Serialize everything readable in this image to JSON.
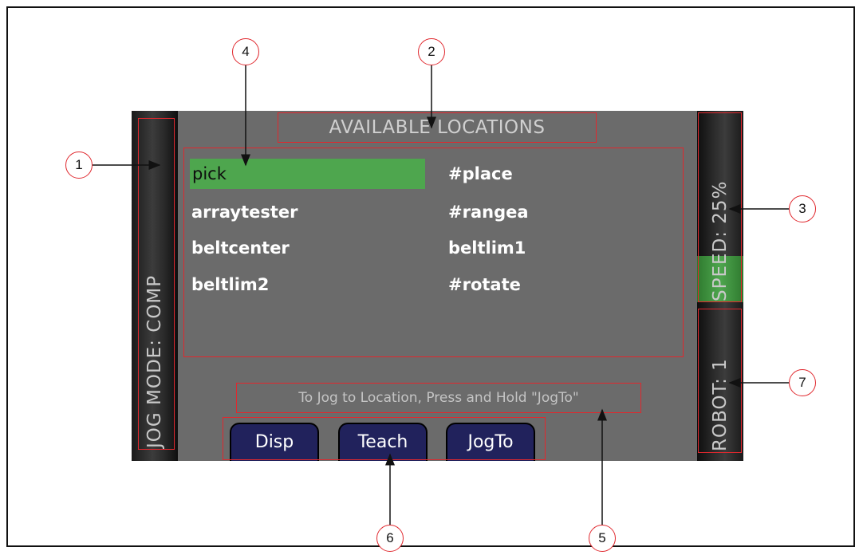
{
  "jog_mode": "JOG MODE: COMP",
  "speed": "SPEED: 25%",
  "robot": "ROBOT: 1",
  "available_title": "AVAILABLE LOCATIONS",
  "locations_col1": [
    "pick",
    "arraytester",
    "beltcenter",
    "beltlim2"
  ],
  "locations_col2": [
    "#place",
    "#rangea",
    "beltlim1",
    "#rotate"
  ],
  "selected_location": "pick",
  "hint": "To Jog to Location, Press and Hold \"JogTo\"",
  "buttons": {
    "disp": "Disp",
    "teach": "Teach",
    "jogto": "JogTo"
  },
  "callouts": [
    "1",
    "2",
    "3",
    "4",
    "5",
    "6",
    "7"
  ],
  "colors": {
    "screen_bg": "#6b6b6b",
    "selected_bg": "#4ea64e",
    "button_bg": "#21225c",
    "highlight_border": "#e0282e"
  }
}
